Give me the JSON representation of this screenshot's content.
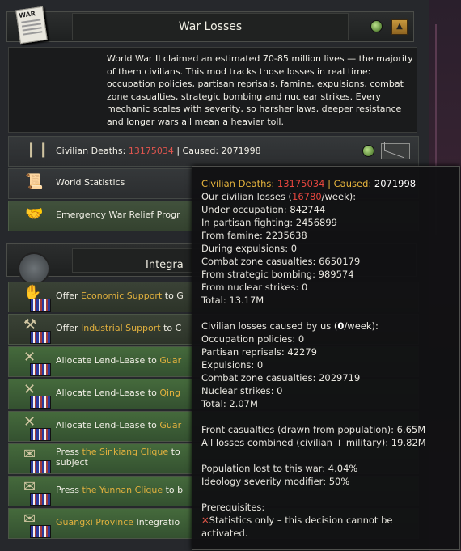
{
  "header": {
    "title": "War Losses",
    "icon_label": "WAR"
  },
  "description": "World War II claimed an estimated 70-85 million lives — the majority of them civilians. This mod tracks those losses in real time: occupation policies, partisan reprisals, famine, expulsions, combat zone casualties, strategic bombing and nuclear strikes. Every mechanic scales with severity, so harsher laws, deeper resistance and longer wars all mean a heavier toll.",
  "rows": {
    "civilian": {
      "label_prefix": "Civilian Deaths: ",
      "deaths": "13175034",
      "sep": " | Caused: ",
      "caused": "2071998"
    },
    "world_stats": "World Statistics",
    "relief": "Emergency War Relief Progr"
  },
  "section": {
    "title": "Integra"
  },
  "decisions": [
    {
      "prefix": "Offer ",
      "highlight": "Economic Support",
      "suffix": " to G"
    },
    {
      "prefix": "Offer ",
      "highlight": "Industrial Support",
      "suffix": " to C"
    },
    {
      "prefix": "Allocate Lend-Lease to ",
      "highlight": "Guar",
      "suffix": ""
    },
    {
      "prefix": "Allocate Lend-Lease to ",
      "highlight": "Qing",
      "suffix": ""
    },
    {
      "prefix": "Allocate Lend-Lease to ",
      "highlight": "Guar",
      "suffix": ""
    },
    {
      "prefix": "Press ",
      "highlight": "the Sinkiang Clique",
      "suffix": " to",
      "line2": "subject"
    },
    {
      "prefix": "Press ",
      "highlight": "the Yunnan Clique",
      "suffix": " to b"
    },
    {
      "prefix": "",
      "highlight": "Guangxi Province",
      "suffix": " Integratio"
    }
  ],
  "tooltip": {
    "head_label": "Civilian Deaths: ",
    "head_deaths": "13175034",
    "head_sep": " | ",
    "head_caused_label": "Caused: ",
    "head_caused": "2071998",
    "our_losses_label": "Our civilian losses (",
    "our_losses_rate": "16780",
    "our_losses_unit": "/week):",
    "lines_a": [
      "Under occupation: 842744",
      "In partisan fighting: 2456899",
      "From famine: 2235638",
      "During expulsions: 0",
      "Combat zone casualties: 6650179",
      "From strategic bombing: 989574",
      "From nuclear strikes: 0"
    ],
    "total_a": "Total: 13.17M",
    "caused_label": "Civilian losses caused by us (",
    "caused_rate": "0",
    "caused_unit": "/week):",
    "lines_b": [
      "Occupation policies: 0",
      "Partisan reprisals: 42279",
      "Expulsions: 0",
      "Combat zone casualties: 2029719",
      "Nuclear strikes: 0"
    ],
    "total_b": "Total: 2.07M",
    "front": "Front casualties (drawn from population): 6.65M",
    "all_losses": "All losses combined (civilian + military): 19.82M",
    "pop_lost": "Population lost to this war: 4.04%",
    "severity": "Ideology severity modifier: 50%",
    "prereq_title": "Prerequisites:",
    "prereq_line1": "Statistics only – this decision cannot be",
    "prereq_line2": "activated."
  },
  "colors": {
    "accent": "#e6b43d",
    "danger": "#e5463e",
    "info": "#4fb2e8"
  }
}
